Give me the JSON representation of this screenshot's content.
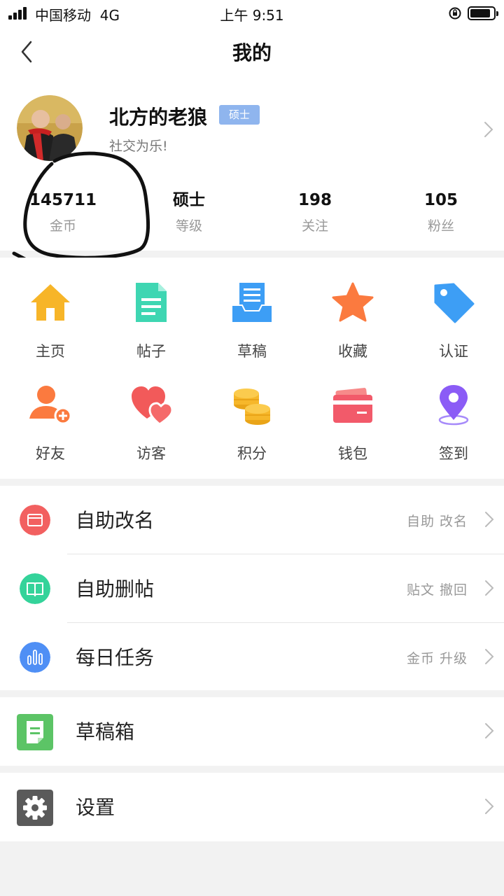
{
  "status_bar": {
    "carrier": "中国移动",
    "network": "4G",
    "time": "上午 9:51"
  },
  "nav": {
    "title": "我的",
    "back_icon": "chevron-left-icon"
  },
  "profile": {
    "username": "北方的老狼",
    "rank_badge": "硕士",
    "bio": "社交为乐!",
    "stats": [
      {
        "value": "145711",
        "label": "金币"
      },
      {
        "value": "硕士",
        "label": "等级"
      },
      {
        "value": "198",
        "label": "关注"
      },
      {
        "value": "105",
        "label": "粉丝"
      }
    ]
  },
  "grid": {
    "items": [
      {
        "label": "主页",
        "icon": "home-icon",
        "color": "#f7b528"
      },
      {
        "label": "帖子",
        "icon": "document-icon",
        "color": "#3ed6b2"
      },
      {
        "label": "草稿",
        "icon": "draft-tray-icon",
        "color": "#3d9ef5"
      },
      {
        "label": "收藏",
        "icon": "star-icon",
        "color": "#fb7a3f"
      },
      {
        "label": "认证",
        "icon": "tag-icon",
        "color": "#3d9ef5"
      },
      {
        "label": "好友",
        "icon": "add-friend-icon",
        "color": "#fb7a3f"
      },
      {
        "label": "访客",
        "icon": "hearts-icon",
        "color": "#f25a5a"
      },
      {
        "label": "积分",
        "icon": "coins-icon",
        "color": "#f6b72a"
      },
      {
        "label": "钱包",
        "icon": "wallet-icon",
        "color": "#f25a6a"
      },
      {
        "label": "签到",
        "icon": "location-pin-icon",
        "color": "#8b5cf6"
      }
    ]
  },
  "menu": {
    "rename": {
      "title": "自助改名",
      "hint": "自助  改名",
      "icon": "card-icon",
      "color": "#f26060"
    },
    "delete_post": {
      "title": "自助删帖",
      "hint": "贴文  撤回",
      "icon": "book-icon",
      "color": "#34d39a"
    },
    "daily_tasks": {
      "title": "每日任务",
      "hint": "金币  升级",
      "icon": "bar-chart-icon",
      "color": "#4f8ff5"
    },
    "drafts_box": {
      "title": "草稿箱",
      "icon": "note-icon",
      "color": "#5cc466"
    },
    "settings": {
      "title": "设置",
      "icon": "gear-icon",
      "color": "#5a5a5a"
    }
  }
}
